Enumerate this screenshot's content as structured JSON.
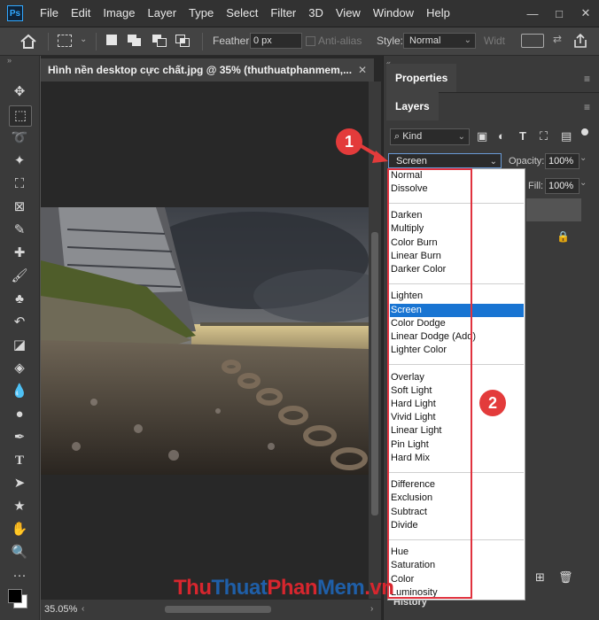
{
  "app": {
    "logo": "Ps"
  },
  "menubar": {
    "items": [
      "File",
      "Edit",
      "Image",
      "Layer",
      "Type",
      "Select",
      "Filter",
      "3D",
      "View",
      "Window",
      "Help"
    ],
    "controls": [
      "—",
      "□",
      "✕"
    ]
  },
  "options_bar": {
    "feather_label": "Feather:",
    "feather_value": "0 px",
    "antialias_label": "Anti-alias",
    "style_label": "Style:",
    "style_value": "Normal",
    "width_label": "Widt"
  },
  "document": {
    "tab_title": "Hình nền desktop cực chất.jpg @ 35% (thuthuatphanmem,...",
    "zoom": "35.05%"
  },
  "panels": {
    "properties_tab": "Properties",
    "layers_tab": "Layers",
    "filter_kind": "Kind",
    "blend_mode": "Screen",
    "opacity_label": "Opacity:",
    "opacity_value": "100%",
    "fill_label": "Fill:",
    "fill_value": "100%",
    "history_label": "History"
  },
  "blend_groups": [
    [
      "Normal",
      "Dissolve"
    ],
    [
      "Darken",
      "Multiply",
      "Color Burn",
      "Linear Burn",
      "Darker Color"
    ],
    [
      "Lighten",
      "Screen",
      "Color Dodge",
      "Linear Dodge (Add)",
      "Lighter Color"
    ],
    [
      "Overlay",
      "Soft Light",
      "Hard Light",
      "Vivid Light",
      "Linear Light",
      "Pin Light",
      "Hard Mix"
    ],
    [
      "Difference",
      "Exclusion",
      "Subtract",
      "Divide"
    ],
    [
      "Hue",
      "Saturation",
      "Color",
      "Luminosity"
    ]
  ],
  "selected_blend": "Screen",
  "annotations": {
    "badge_1": "1",
    "badge_2": "2"
  },
  "watermark": {
    "thu": "Thu",
    "thuat": "Thuat",
    "phan": "Phan",
    "mem": "Mem",
    "vn": ".vn"
  },
  "colors": {
    "selection": "#1874d2",
    "annotation_red": "#e33b3b",
    "watermark_red": "#d7262e",
    "watermark_blue": "#1f5fa8"
  }
}
